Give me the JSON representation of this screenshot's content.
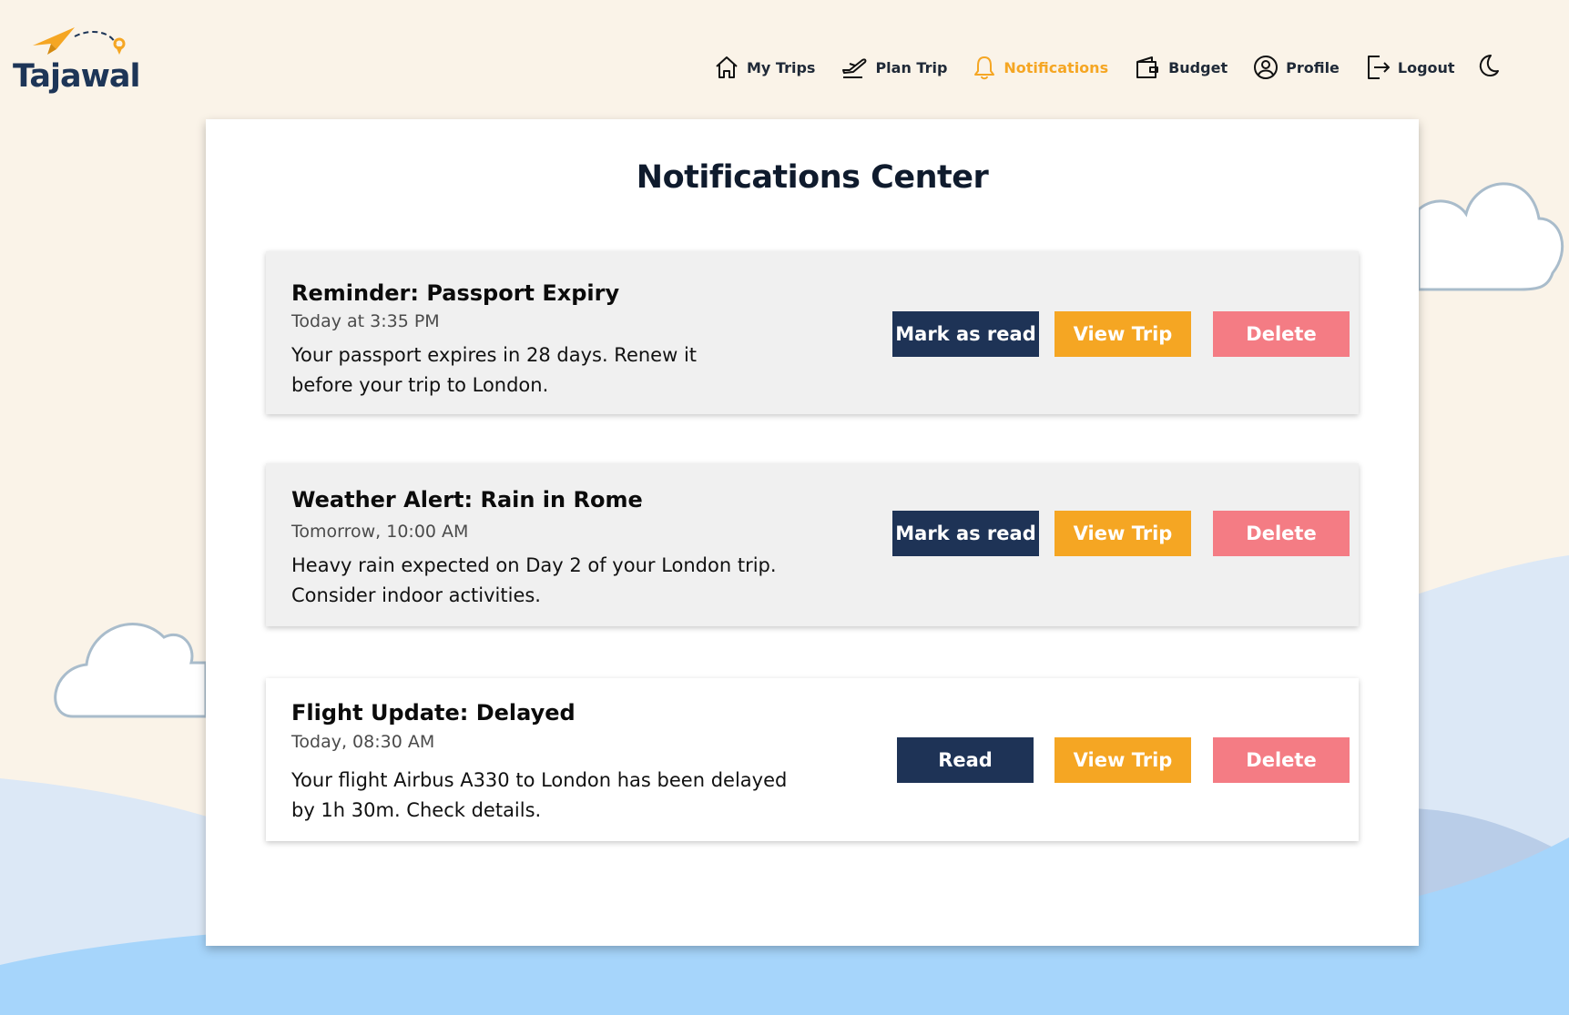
{
  "brand": {
    "name": "Tajawal"
  },
  "nav": {
    "items": [
      {
        "label": "My Trips",
        "icon": "home-icon"
      },
      {
        "label": "Plan Trip",
        "icon": "plane-icon"
      },
      {
        "label": "Notifications",
        "icon": "bell-icon",
        "active": true
      },
      {
        "label": "Budget",
        "icon": "wallet-icon"
      },
      {
        "label": "Profile",
        "icon": "user-circle-icon"
      },
      {
        "label": "Logout",
        "icon": "logout-icon"
      }
    ],
    "theme_toggle_icon": "moon-icon"
  },
  "page": {
    "title": "Notifications Center"
  },
  "notifications": [
    {
      "title": "Reminder: Passport Expiry",
      "time": "Today at 3:35 PM",
      "body": "Your passport expires in 28 days. Renew it\nbefore your trip to London.",
      "primary_action": "Mark as read",
      "view_action": "View Trip",
      "delete_action": "Delete",
      "read": false
    },
    {
      "title": "Weather Alert: Rain in Rome",
      "time": "Tomorrow, 10:00 AM",
      "body": "Heavy rain expected on Day 2 of your London trip.\nConsider indoor activities.",
      "primary_action": "Mark as read",
      "view_action": "View Trip",
      "delete_action": "Delete",
      "read": false
    },
    {
      "title": "Flight Update: Delayed",
      "time": "Today, 08:30 AM",
      "body": "Your flight Airbus A330 to London has been delayed\n by 1h 30m. Check details.",
      "primary_action": "Read",
      "view_action": "View Trip",
      "delete_action": "Delete",
      "read": true
    }
  ],
  "colors": {
    "primary": "#1e3356",
    "accent": "#f5a623",
    "danger": "#f47c84",
    "background": "#faf3e8"
  }
}
